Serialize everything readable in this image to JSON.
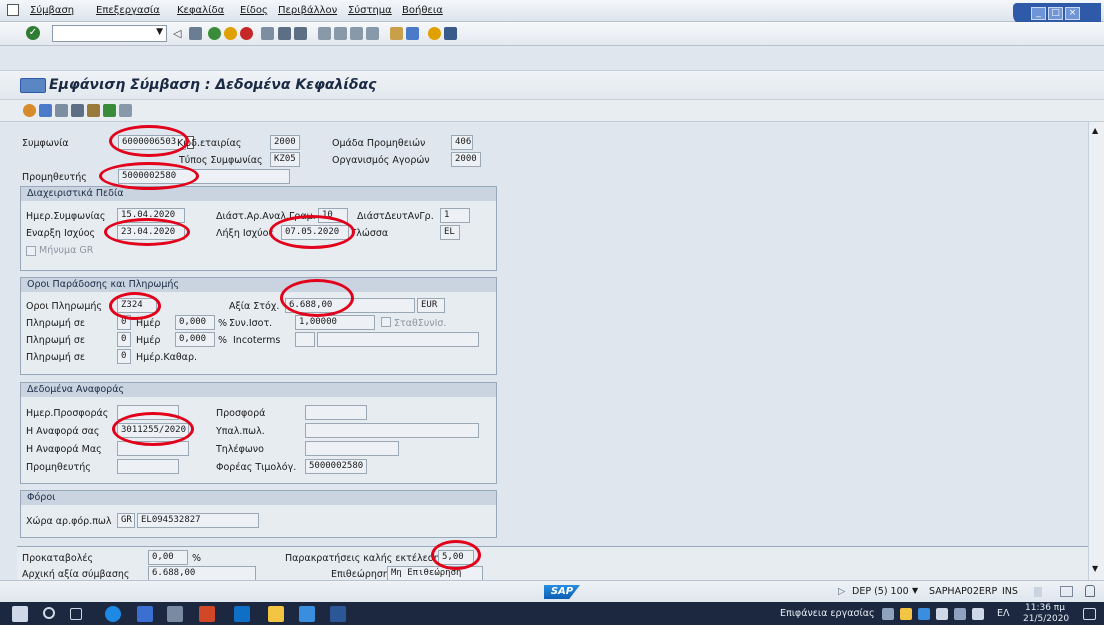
{
  "menu": [
    "Σύμβαση",
    "Επεξεργασία",
    "Κεφαλίδα",
    "Είδος",
    "Περιβάλλον",
    "Σύστημα",
    "Βοήθεια"
  ],
  "title": "Εμφάνιση Σύμβαση : Δεδομένα Κεφαλίδας",
  "header": {
    "agreement_label": "Συμφωνία",
    "agreement_value": "6000006503",
    "company_label": "Κωδ.εταιρίας",
    "company_value": "2000",
    "type_label": "Τύπος Συμφωνίας",
    "type_value": "KZ05",
    "purch_group_label": "Ομάδα Προμηθειών",
    "purch_group_value": "406",
    "purch_org_label": "Οργανισμός Αγορών",
    "purch_org_value": "2000",
    "vendor_label": "Προμηθευτής",
    "vendor_value": "5000002580"
  },
  "admin": {
    "title": "Διαχειριστικά Πεδία",
    "agreement_date_label": "Ημερ.Συμφωνίας",
    "agreement_date_value": "15.04.2020",
    "item_interval_label": "Διάστ.Αρ.Αναλ.Γραμ.",
    "item_interval_value": "10",
    "sub_interval_label": "ΔιάστΔευτΑνΓρ.",
    "sub_interval_value": "1",
    "valid_from_label": "Εναρξη Ισχύος",
    "valid_from_value": "23.04.2020",
    "valid_to_label": "Λήξη Ισχύος",
    "valid_to_value": "07.05.2020",
    "language_label": "Γλώσσα",
    "language_value": "EL",
    "gr_message_label": "Μήνυμα GR"
  },
  "payment": {
    "title": "Οροι Παράδοσης και Πληρωμής",
    "terms_label": "Οροι Πληρωμής",
    "terms_value": "Z324",
    "target_value_label": "Αξία Στόχ.",
    "target_value": "6.688,00",
    "currency": "EUR",
    "pay_in_label": "Πληρωμή σε",
    "days_label": "Ημέρ",
    "pct_sign": "%",
    "row1_days": "0",
    "row1_pct": "0,000",
    "row2_days": "0",
    "row2_pct": "0,000",
    "row3_days": "0",
    "net_days_label": "Ημέρ.Καθαρ.",
    "exch_rate_label": "Συν.Ισοτ.",
    "exch_rate_value": "1,00000",
    "fixed_rate_label": "ΣταθΣυνΙσ.",
    "incoterms_label": "Incoterms"
  },
  "reference": {
    "title": "Δεδομένα Αναφοράς",
    "quot_date_label": "Ημερ.Προσφοράς",
    "quotation_label": "Προσφορά",
    "your_ref_label": "Η Αναφορά σας",
    "your_ref_value": "3011255/2020",
    "salesperson_label": "Υπαλ.πωλ.",
    "our_ref_label": "Η Αναφορά Μας",
    "telephone_label": "Τηλέφωνο",
    "supplier_label": "Προμηθευτής",
    "invoicing_party_label": "Φορέας Τιμολόγ.",
    "invoicing_party_value": "5000002580"
  },
  "taxes": {
    "title": "Φόροι",
    "country_label": "Χώρα αρ.φόρ.πωλ",
    "country_code": "GR",
    "vat_value": "EL094532827"
  },
  "bottom": {
    "downpayment_label": "Προκαταβολές",
    "downpayment_value": "0,00",
    "pct_sign": "%",
    "retention_label": "Παρακρατήσεις καλής εκτέλεσης",
    "retention_value": "5,00",
    "initial_value_label": "Αρχική αξία σύμβασης",
    "initial_value": "6.688,00",
    "review_label": "Επιθεώρηση",
    "review_value": "Μη Επιθεώρηση"
  },
  "status": {
    "sap_logo": "SAP",
    "system": "DEP (5) 100",
    "server": "SAPHAP02ERP",
    "mode": "INS"
  },
  "taskbar": {
    "desktop_label": "Επιφάνεια εργασίας",
    "lang": "ΕΛ",
    "time": "11:36 πμ",
    "date": "21/5/2020"
  },
  "colors": {
    "accent": "#2f5aa8",
    "highlight_circle": "#e2001a"
  }
}
